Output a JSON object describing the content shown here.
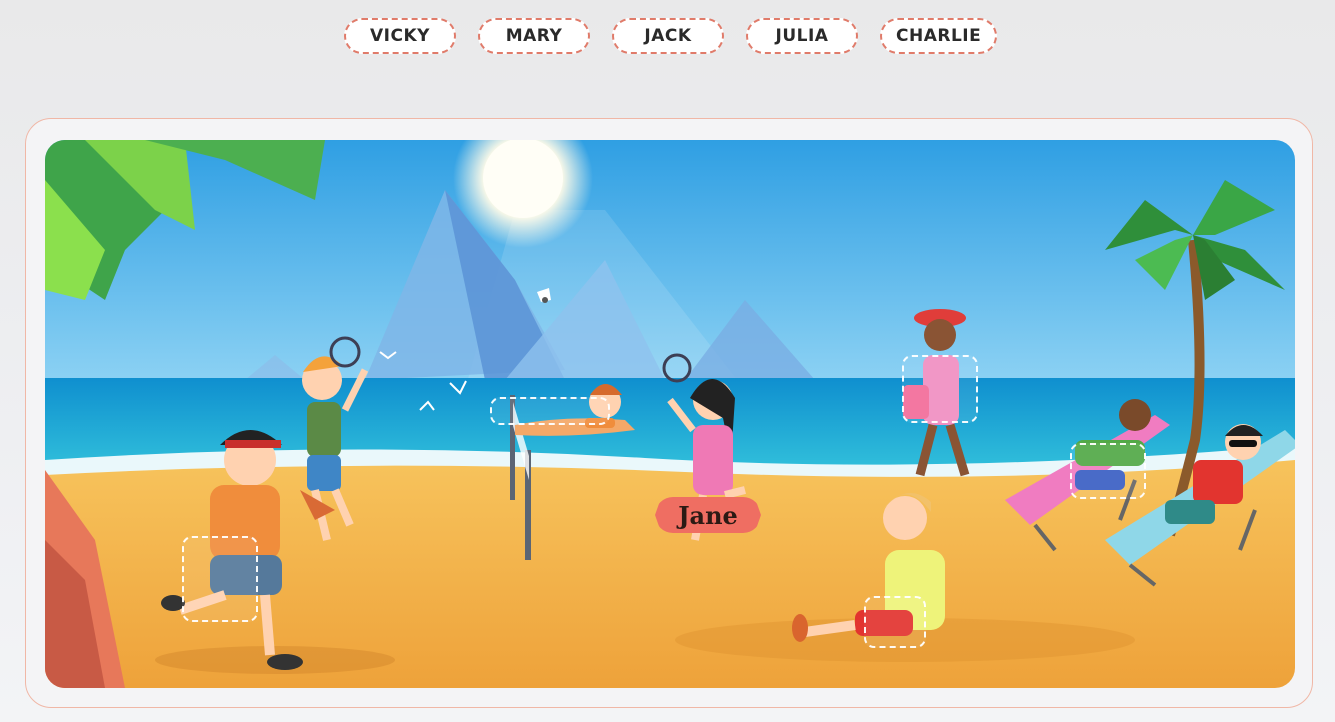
{
  "names": [
    {
      "id": "vicky",
      "label": "VICKY"
    },
    {
      "id": "mary",
      "label": "MARY"
    },
    {
      "id": "jack",
      "label": "JACK"
    },
    {
      "id": "julia",
      "label": "JULIA"
    },
    {
      "id": "charlie",
      "label": "CHARLIE"
    }
  ],
  "scene": {
    "given_label": "Jane",
    "icons": [
      "sun-icon",
      "mountain-icon",
      "palm-tree-icon",
      "shuttlecock-icon",
      "badminton-net-icon",
      "deck-chair-icon"
    ]
  },
  "colors": {
    "chip_border": "#e07b6a",
    "label_bg": "#ef6e62",
    "sky": "#3fb1ea",
    "sea": "#1aa8d8",
    "sand": "#f5b44a"
  }
}
